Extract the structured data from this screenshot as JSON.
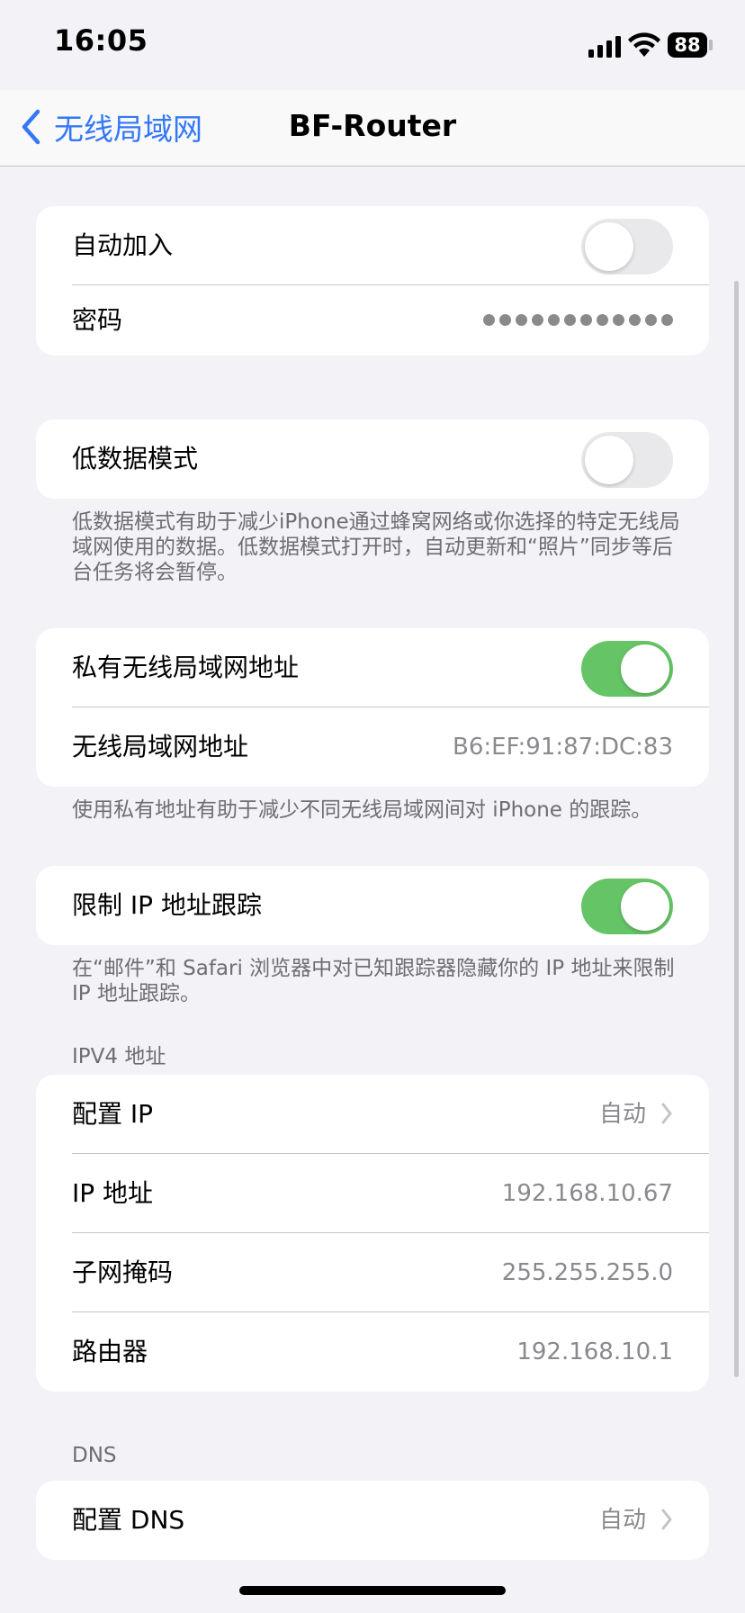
{
  "status_bar": {
    "time": "16:05",
    "battery": "88"
  },
  "nav": {
    "back_label": "无线局域网",
    "title": "BF-Router"
  },
  "group1": {
    "auto_join_label": "自动加入",
    "password_label": "密码"
  },
  "low_data": {
    "label": "低数据模式",
    "footer": "低数据模式有助于减少iPhone通过蜂窝网络或你选择的特定无线局域网使用的数据。低数据模式打开时，自动更新和“照片”同步等后台任务将会暂停。"
  },
  "private_addr": {
    "label": "私有无线局域网地址",
    "wifi_address_label": "无线局域网地址",
    "wifi_address_value": "B6:EF:91:87:DC:83",
    "footer": "使用私有地址有助于减少不同无线局域网间对 iPhone 的跟踪。"
  },
  "limit_ip": {
    "label": "限制 IP 地址跟踪",
    "footer": "在“邮件”和 Safari 浏览器中对已知跟踪器隐藏你的 IP 地址来限制 IP 地址跟踪。"
  },
  "ipv4": {
    "header": "IPV4 地址",
    "rows": [
      {
        "label": "配置 IP",
        "value": "自动"
      },
      {
        "label": "IP 地址",
        "value": "192.168.10.67"
      },
      {
        "label": "子网掩码",
        "value": "255.255.255.0"
      },
      {
        "label": "路由器",
        "value": "192.168.10.1"
      }
    ]
  },
  "dns": {
    "header": "DNS",
    "configure_label": "配置 DNS",
    "configure_value": "自动"
  },
  "toggles": {
    "auto_join": false,
    "low_data": false,
    "private_address": true,
    "limit_ip_tracking": true
  },
  "colors": {
    "accent": "#3478f6",
    "toggle_on": "#65c466",
    "background": "#f2f2f7"
  },
  "icons": [
    "chevron-left-icon",
    "chevron-right-icon",
    "cellular-signal-icon",
    "wifi-icon",
    "battery-icon"
  ]
}
